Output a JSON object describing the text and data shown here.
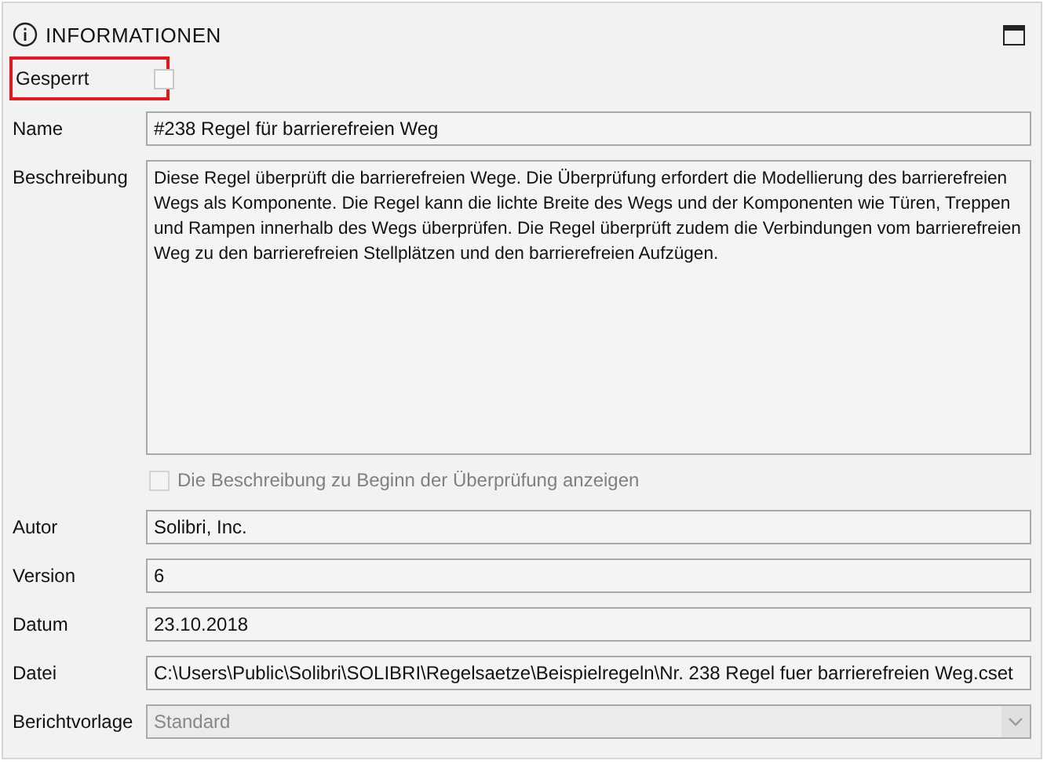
{
  "panel": {
    "title": "INFORMATIONEN"
  },
  "fields": [
    {
      "kind": "checkbox",
      "label": "Gesperrt",
      "checked": false,
      "highlighted": true
    },
    {
      "kind": "text",
      "label": "Name",
      "value": "#238 Regel für barrierefreien Weg"
    },
    {
      "kind": "textarea",
      "label": "Beschreibung",
      "value": "Diese Regel überprüft die barrierefreien Wege. Die Überprüfung erfordert die Modellierung des barrierefreien Wegs als Komponente. Die Regel kann die lichte Breite des Wegs und der Komponenten wie Türen, Treppen und Rampen innerhalb des Wegs überprüfen. Die Regel überprüft zudem die Verbindungen vom barrierefreien Weg zu den barrierefreien Stellplätzen und den barrierefreien Aufzügen."
    },
    {
      "kind": "option",
      "label": "Die Beschreibung zu Beginn der Überprüfung anzeigen",
      "checked": false,
      "disabled": true
    },
    {
      "kind": "text",
      "label": "Autor",
      "value": "Solibri, Inc."
    },
    {
      "kind": "text",
      "label": "Version",
      "value": "6"
    },
    {
      "kind": "text",
      "label": "Datum",
      "value": "23.10.2018"
    },
    {
      "kind": "text",
      "label": "Datei",
      "value": "C:\\Users\\Public\\Solibri\\SOLIBRI\\Regelsaetze\\Beispielregeln\\Nr. 238 Regel fuer barrierefreien Weg.cset"
    },
    {
      "kind": "combo",
      "label": "Berichtvorlage",
      "value": "Standard",
      "disabled": true
    }
  ]
}
